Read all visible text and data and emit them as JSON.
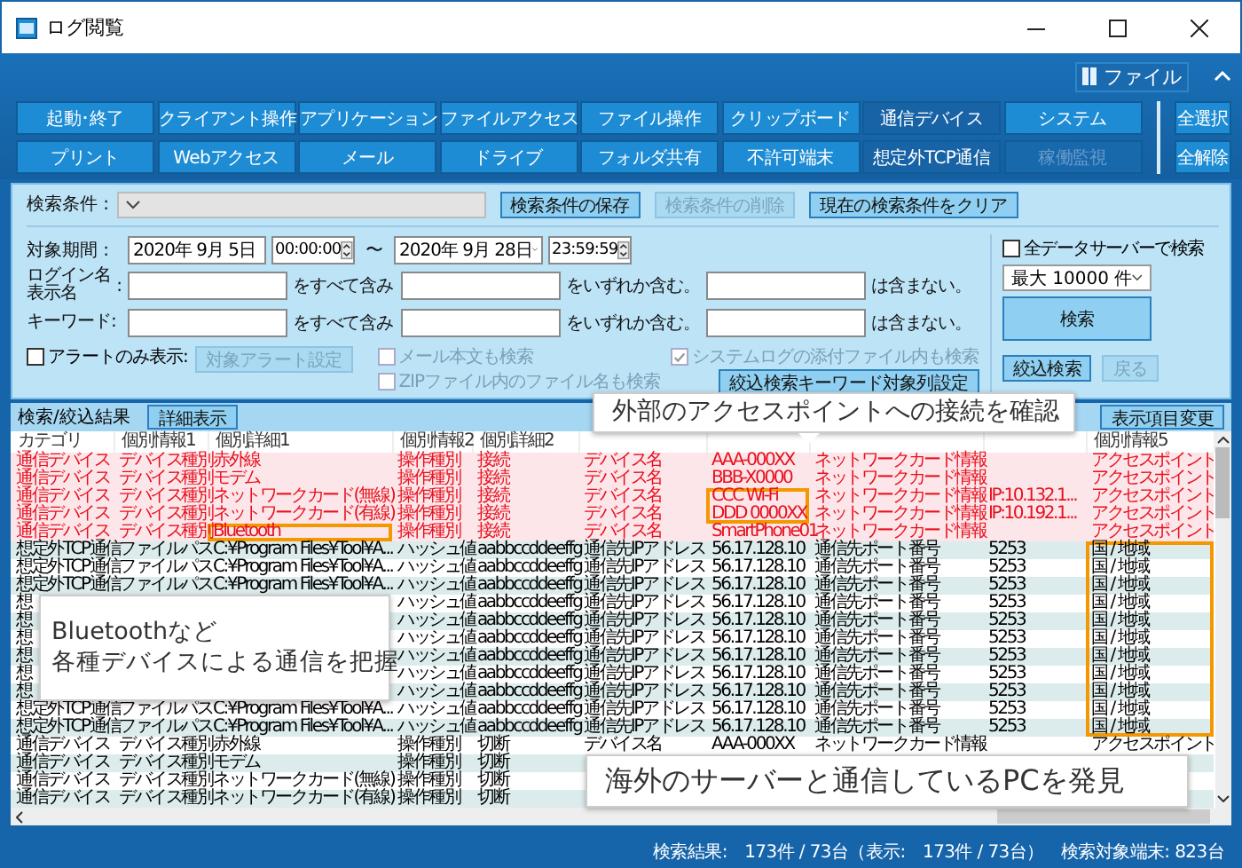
{
  "window": {
    "title": "ログ閲覧"
  },
  "ribbon": {
    "file_button": "ファイル",
    "filters": [
      {
        "label": "起動･終了",
        "selected": false,
        "disabled": false
      },
      {
        "label": "クライアント操作",
        "selected": false,
        "disabled": false
      },
      {
        "label": "アプリケーション",
        "selected": false,
        "disabled": false
      },
      {
        "label": "ファイルアクセス",
        "selected": false,
        "disabled": false
      },
      {
        "label": "ファイル操作",
        "selected": false,
        "disabled": false
      },
      {
        "label": "クリップボード",
        "selected": false,
        "disabled": false
      },
      {
        "label": "通信デバイス",
        "selected": true,
        "disabled": false
      },
      {
        "label": "システム",
        "selected": false,
        "disabled": false
      },
      {
        "label": "プリント",
        "selected": false,
        "disabled": false
      },
      {
        "label": "Webアクセス",
        "selected": false,
        "disabled": false
      },
      {
        "label": "メール",
        "selected": false,
        "disabled": false
      },
      {
        "label": "ドライブ",
        "selected": false,
        "disabled": false
      },
      {
        "label": "フォルダ共有",
        "selected": false,
        "disabled": false
      },
      {
        "label": "不許可端末",
        "selected": false,
        "disabled": false
      },
      {
        "label": "想定外TCP通信",
        "selected": true,
        "disabled": false
      },
      {
        "label": "稼働監視",
        "selected": false,
        "disabled": true
      }
    ],
    "select_all": "全選択",
    "clear_all": "全解除"
  },
  "search": {
    "condition_label": "検索条件 :",
    "condition_buttons": [
      {
        "label": "検索条件の保存",
        "disabled": false
      },
      {
        "label": "検索条件の削除",
        "disabled": true
      },
      {
        "label": "現在の検索条件をクリア",
        "disabled": false
      }
    ],
    "period_label": "対象期間 :",
    "start_date": "2020年 9月 5日",
    "start_time": "00:00:00",
    "range_sep": "〜",
    "end_date": "2020年 9月 28日",
    "end_time": "23:59:59",
    "filter_rows": [
      {
        "label_lines": [
          "ログイン名",
          "表示名"
        ],
        "colon": ":",
        "all_suffix": "をすべて含み",
        "any_suffix": "をいずれか含む。",
        "none_suffix": "は含まない。"
      },
      {
        "label_lines": [
          "キーワード:"
        ],
        "all_suffix": "をすべて含み",
        "any_suffix": "をいずれか含む。",
        "none_suffix": "は含まない。"
      }
    ],
    "alert_only": {
      "label": "アラートのみ表示:",
      "checked": false
    },
    "alert_settings": {
      "label": "対象アラート設定",
      "disabled": true
    },
    "options": [
      {
        "label": "メール本文も検索",
        "checked": false,
        "disabled": true
      },
      {
        "label": "システムログの添付ファイル内も検索",
        "checked": true,
        "disabled": true
      },
      {
        "label": "ZIPファイル内のファイル名も検索",
        "checked": false,
        "disabled": true
      }
    ],
    "column_settings": "絞込検索キーワード対象列設定",
    "all_servers": {
      "label": "全データサーバーで検索",
      "checked": false
    },
    "max_results": "最大 10000 件",
    "search_button": "検索",
    "refine_button": "絞込検索",
    "back": {
      "label": "戻る",
      "disabled": true
    }
  },
  "results": {
    "tab": "検索/絞込結果",
    "detail_button": "詳細表示",
    "columns_button": "表示項目変更",
    "columns": [
      "カテゴリ",
      "個別情報1",
      "個別詳細1",
      "個別情報2",
      "個別詳細2",
      null,
      null,
      null,
      null,
      "個別情報5"
    ],
    "rows": [
      {
        "kind": "alert",
        "cells": [
          "通信デバイス",
          "デバイス種別",
          "赤外線",
          "操作種別",
          "接続",
          "デバイス名",
          "AAA-000XX",
          "ネットワークカード情報",
          null,
          "アクセスポイント"
        ]
      },
      {
        "kind": "alert",
        "cells": [
          "通信デバイス",
          "デバイス種別",
          "モデム",
          "操作種別",
          "接続",
          "デバイス名",
          "BBB-X0000",
          "ネットワークカード情報",
          null,
          "アクセスポイント"
        ]
      },
      {
        "kind": "alert",
        "cells": [
          "通信デバイス",
          "デバイス種別",
          "ネットワークカード(無線)",
          "操作種別",
          "接続",
          "デバイス名",
          {
            "text": "CCC Wi-Fi",
            "framed": true
          },
          "ネットワークカード情報",
          "IP:10.132.1...",
          "アクセスポイント"
        ]
      },
      {
        "kind": "alert",
        "cells": [
          "通信デバイス",
          "デバイス種別",
          "ネットワークカード(有線)",
          "操作種別",
          "接続",
          "デバイス名",
          {
            "text": "DDD 0000XX",
            "framed": true
          },
          "ネットワークカード情報",
          "IP:10.192.1...",
          "アクセスポイント"
        ]
      },
      {
        "kind": "alert",
        "cells": [
          "通信デバイス",
          "デバイス種別",
          {
            "text": "Bluetooth",
            "framed": true
          },
          "操作種別",
          "接続",
          "デバイス名",
          "SmartPhone01",
          "ネットワークカード情報",
          null,
          "アクセスポイント"
        ]
      },
      {
        "kind": "normal",
        "cells": [
          "想定外TCP通信",
          "ファイルパス",
          "C:¥Program Files¥Tool¥A...",
          "ハッシュ値",
          "aabbccddeeffg",
          "通信先IPアドレス",
          "56.17.128.10",
          "通信先ポート番号",
          "5253",
          {
            "text": "国 / 地域",
            "framed": true
          }
        ]
      },
      {
        "kind": "normal",
        "cells": [
          "想定外TCP通信",
          "ファイルパス",
          "C:¥Program Files¥Tool¥A...",
          "ハッシュ値",
          "aabbccddeeffg",
          "通信先IPアドレス",
          "56.17.128.10",
          "通信先ポート番号",
          "5253",
          {
            "text": "国 / 地域",
            "framed": true
          }
        ]
      },
      {
        "kind": "normal",
        "cells": [
          "想定外TCP通信",
          "ファイルパス",
          "C:¥Program Files¥Tool¥A...",
          "ハッシュ値",
          "aabbccddeeffg",
          "通信先IPアドレス",
          "56.17.128.10",
          "通信先ポート番号",
          "5253",
          {
            "text": "国 / 地域",
            "framed": true
          }
        ]
      },
      {
        "kind": "normal",
        "cells": [
          "想",
          null,
          null,
          "ハッシュ値",
          "aabbccddeeffg",
          "通信先IPアドレス",
          "56.17.128.10",
          "通信先ポート番号",
          "5253",
          {
            "text": "国 / 地域",
            "framed": true
          }
        ]
      },
      {
        "kind": "normal",
        "cells": [
          "想",
          null,
          null,
          "ハッシュ値",
          "aabbccddeeffg",
          "通信先IPアドレス",
          "56.17.128.10",
          "通信先ポート番号",
          "5253",
          {
            "text": "国 / 地域",
            "framed": true
          }
        ]
      },
      {
        "kind": "normal",
        "cells": [
          "想",
          null,
          null,
          "ハッシュ値",
          "aabbccddeeffg",
          "通信先IPアドレス",
          "56.17.128.10",
          "通信先ポート番号",
          "5253",
          {
            "text": "国 / 地域",
            "framed": true
          }
        ]
      },
      {
        "kind": "normal",
        "cells": [
          "想",
          null,
          null,
          "ハッシュ値",
          "aabbccddeeffg",
          "通信先IPアドレス",
          "56.17.128.10",
          "通信先ポート番号",
          "5253",
          {
            "text": "国 / 地域",
            "framed": true
          }
        ]
      },
      {
        "kind": "normal",
        "cells": [
          "想",
          null,
          null,
          "ハッシュ値",
          "aabbccddeeffg",
          "通信先IPアドレス",
          "56.17.128.10",
          "通信先ポート番号",
          "5253",
          {
            "text": "国 / 地域",
            "framed": true
          }
        ]
      },
      {
        "kind": "normal",
        "cells": [
          "想",
          null,
          null,
          "ハッシュ値",
          "aabbccddeeffg",
          "通信先IPアドレス",
          "56.17.128.10",
          "通信先ポート番号",
          "5253",
          {
            "text": "国 / 地域",
            "framed": true
          }
        ]
      },
      {
        "kind": "normal",
        "cells": [
          "想定外TCP通信",
          "ファイルパス",
          "C:¥Program Files¥Tool¥A...",
          "ハッシュ値",
          "aabbccddeeffg",
          "通信先IPアドレス",
          "56.17.128.10",
          "通信先ポート番号",
          "5253",
          {
            "text": "国 / 地域",
            "framed": true
          }
        ]
      },
      {
        "kind": "normal",
        "cells": [
          "想定外TCP通信",
          "ファイルパス",
          "C:¥Program Files¥Tool¥A...",
          "ハッシュ値",
          "aabbccddeeffg",
          "通信先IPアドレス",
          "56.17.128.10",
          "通信先ポート番号",
          "5253",
          {
            "text": "国 / 地域",
            "framed": true
          }
        ]
      },
      {
        "kind": "normal",
        "cells": [
          "通信デバイス",
          "デバイス種別",
          "赤外線",
          "操作種別",
          "切断",
          "デバイス名",
          "AAA-000XX",
          "ネットワークカード情報",
          null,
          "アクセスポイント"
        ]
      },
      {
        "kind": "normal",
        "cells": [
          "通信デバイス",
          "デバイス種別",
          "モデム",
          "操作種別",
          "切断",
          null,
          null,
          null,
          null,
          null
        ]
      },
      {
        "kind": "normal",
        "cells": [
          "通信デバイス",
          "デバイス種別",
          "ネットワークカード(無線)",
          "操作種別",
          "切断",
          null,
          null,
          null,
          null,
          null
        ]
      },
      {
        "kind": "normal",
        "cells": [
          "通信デバイス",
          "デバイス種別",
          "ネットワークカード(有線)",
          "操作種別",
          "切断",
          null,
          null,
          null,
          null,
          null
        ]
      }
    ]
  },
  "callouts": [
    {
      "kind": "top",
      "lines": [
        "外部のアクセスポイントへの接続を確認"
      ]
    },
    {
      "kind": "left",
      "lines": [
        "Bluetoothなど",
        "各種デバイスによる通信を把握"
      ]
    },
    {
      "kind": "right",
      "lines": [
        "海外のサーバーと通信しているPCを発見"
      ]
    }
  ],
  "status_bar": "検索結果:　173件 / 73台（表示:　173件 / 73台）　検索対象端末: 823台"
}
